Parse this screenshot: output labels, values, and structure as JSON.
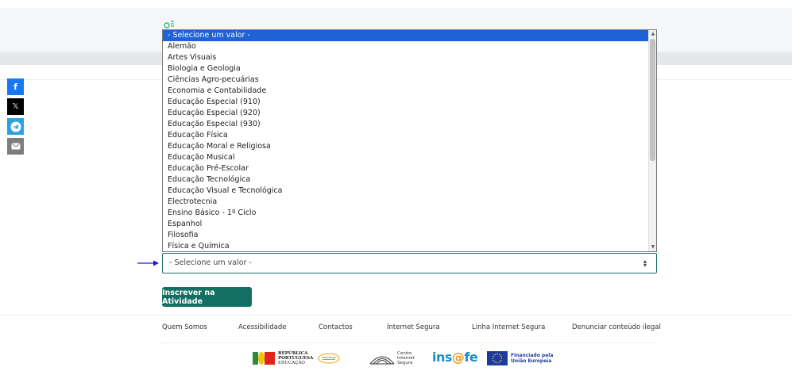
{
  "listbox": {
    "options": [
      "- Selecione um valor -",
      "Alemão",
      "Artes Visuais",
      "Biologia e Geologia",
      "Ciências Agro-pecuárias",
      "Economia e Contabilidade",
      "Educação Especial (910)",
      "Educação Especial (920)",
      "Educação Especial (930)",
      "Educação Física",
      "Educação Moral e Religiosa",
      "Educação Musical",
      "Educação Pré-Escolar",
      "Educação Tecnológica",
      "Educação Visual e Tecnológica",
      "Electrotecnia",
      "Ensino Básico - 1º Ciclo",
      "Espanhol",
      "Filosofia",
      "Física e Química"
    ],
    "selected_index": 0
  },
  "select": {
    "value": "- Selecione um valor -"
  },
  "button": {
    "label": "Inscrever na Atividade"
  },
  "social": {
    "facebook": "f",
    "x": "𝕏",
    "colors": {
      "facebook": "#1877f2",
      "x": "#000000",
      "telegram": "#2aa3df",
      "email": "#7d7d7d"
    }
  },
  "footer": {
    "links": [
      "Quem Somos",
      "Acessibilidade",
      "Contactos",
      "Internet Segura",
      "Linha Internet Segura",
      "Denunciar conteúdo ilegal"
    ]
  },
  "partners": {
    "republica": [
      "REPÚBLICA",
      "PORTUGUESA",
      "EDUCAÇÃO"
    ],
    "cis": [
      "Centro",
      "Internet",
      "Segura"
    ],
    "insafe_prefix": "ins",
    "insafe_at": "@",
    "insafe_suffix": "fe",
    "eu": [
      "Financiado pela",
      "União Europeia"
    ]
  },
  "colors": {
    "accent": "#136f62",
    "selection": "#1e62d6"
  }
}
